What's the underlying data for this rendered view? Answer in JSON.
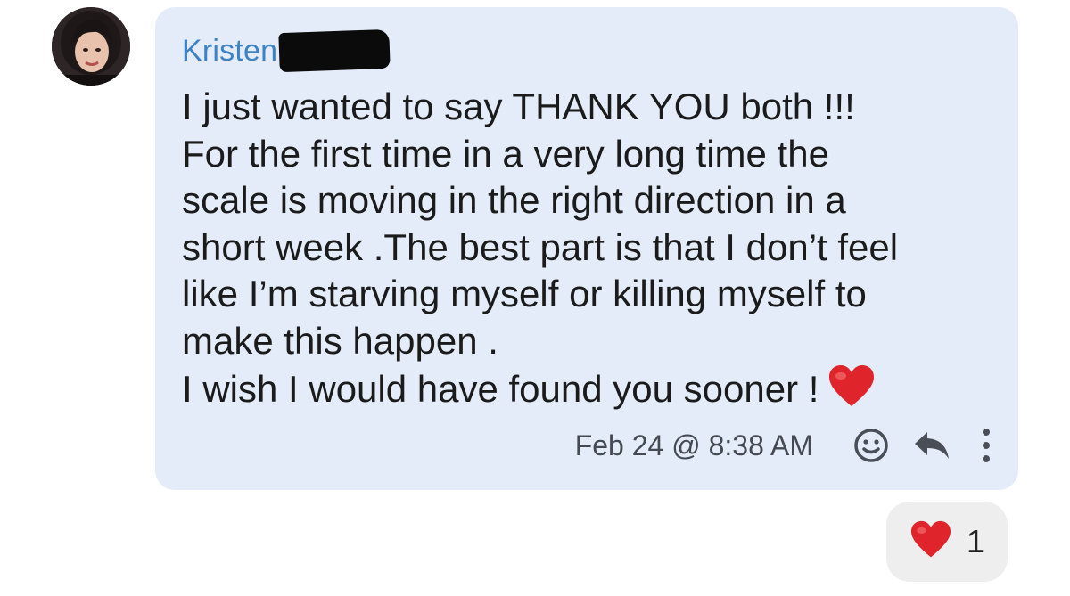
{
  "post": {
    "author": "Kristen",
    "message": "I just wanted to say THANK YOU both !!!\nFor the first time in a very long time the\nscale is moving in the right direction in a\nshort week .The best part is that I don’t feel\nlike I’m starving myself or killing myself to\nmake this happen .\nI wish I would have found you sooner !",
    "timestamp": "Feb 24 @ 8:38 AM"
  },
  "reaction": {
    "icon": "heart-icon",
    "count": "1"
  },
  "icons": {
    "message_end": "heart-icon",
    "react": "smiley-icon",
    "reply": "reply-arrow-icon",
    "more": "more-vertical-icon"
  },
  "colors": {
    "bubble_bg": "#e3ecf8",
    "author_name": "#3d82c4",
    "heart": "#e0242b",
    "reaction_bg": "#eeeeee"
  }
}
